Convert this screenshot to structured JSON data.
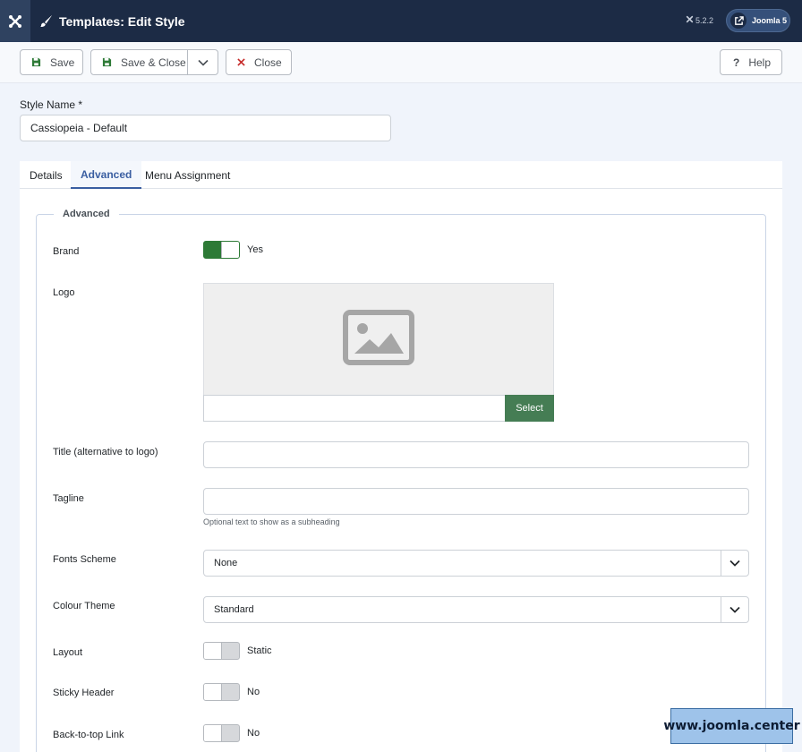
{
  "header": {
    "title": "Templates: Edit Style",
    "version": "5.2.2",
    "joomla_label": "Joomla 5"
  },
  "toolbar": {
    "save_label": "Save",
    "save_close_label": "Save & Close",
    "close_label": "Close",
    "help_label": "Help"
  },
  "style_name": {
    "label": "Style Name *",
    "value": "Cassiopeia - Default"
  },
  "tabs": [
    {
      "label": "Details",
      "active": false
    },
    {
      "label": "Advanced",
      "active": true
    },
    {
      "label": "Menu Assignment",
      "active": false
    }
  ],
  "advanced": {
    "legend": "Advanced",
    "brand": {
      "label": "Brand",
      "state": "Yes",
      "on": true
    },
    "logo": {
      "label": "Logo",
      "select_label": "Select",
      "icon": "image-placeholder-icon"
    },
    "title": {
      "label": "Title (alternative to logo)",
      "value": ""
    },
    "tagline": {
      "label": "Tagline",
      "value": "",
      "hint": "Optional text to show as a subheading"
    },
    "fonts_scheme": {
      "label": "Fonts Scheme",
      "value": "None"
    },
    "colour_theme": {
      "label": "Colour Theme",
      "value": "Standard"
    },
    "layout": {
      "label": "Layout",
      "state": "Static",
      "on": false
    },
    "sticky_header": {
      "label": "Sticky Header",
      "state": "No",
      "on": false
    },
    "back_to_top": {
      "label": "Back-to-top Link",
      "state": "No",
      "on": false
    }
  },
  "watermark": "www.joomla.center",
  "colors": {
    "header_bg": "#1c2b45",
    "switch_on": "#2d7a36",
    "select_button": "#457d54",
    "active_tab": "#3a5ea1",
    "close_x": "#c52827"
  }
}
